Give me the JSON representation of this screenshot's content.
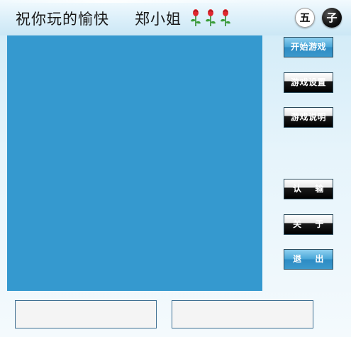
{
  "header": {
    "greeting": "祝你玩的愉快",
    "username": "郑小姐",
    "rose_count": 3,
    "logo_left": "五",
    "logo_right": "子"
  },
  "board": {
    "color": "#3599cf"
  },
  "buttons": {
    "start": "开始游戏",
    "settings": "游戏设置",
    "help": "游戏说明",
    "resign": "认    输",
    "about": "关    于",
    "exit": "退    出"
  },
  "colors": {
    "button_blue": "#3a98cc",
    "button_dark": "#000000",
    "panel_border": "#3f6f92"
  }
}
